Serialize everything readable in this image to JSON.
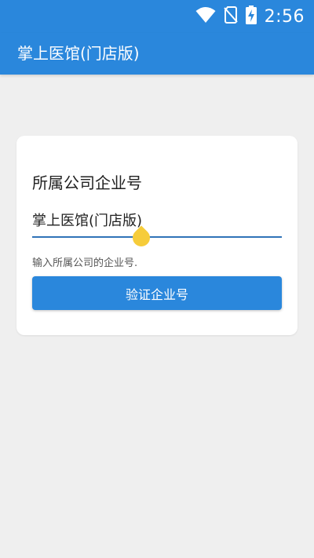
{
  "status_bar": {
    "time": "2:56",
    "icons": [
      "wifi-icon",
      "no-sim-icon",
      "battery-charging-icon"
    ]
  },
  "app_bar": {
    "title": "掌上医馆(门店版)"
  },
  "card": {
    "heading": "所属公司企业号",
    "input": {
      "value": "掌上医馆(门店版)",
      "placeholder": ""
    },
    "helper_text": "输入所属公司的企业号.",
    "verify_button_label": "验证企业号"
  },
  "colors": {
    "primary": "#2a87dc",
    "background": "#efefef",
    "cursor_handle": "#f6cc3a",
    "underline": "#2f73b8"
  }
}
